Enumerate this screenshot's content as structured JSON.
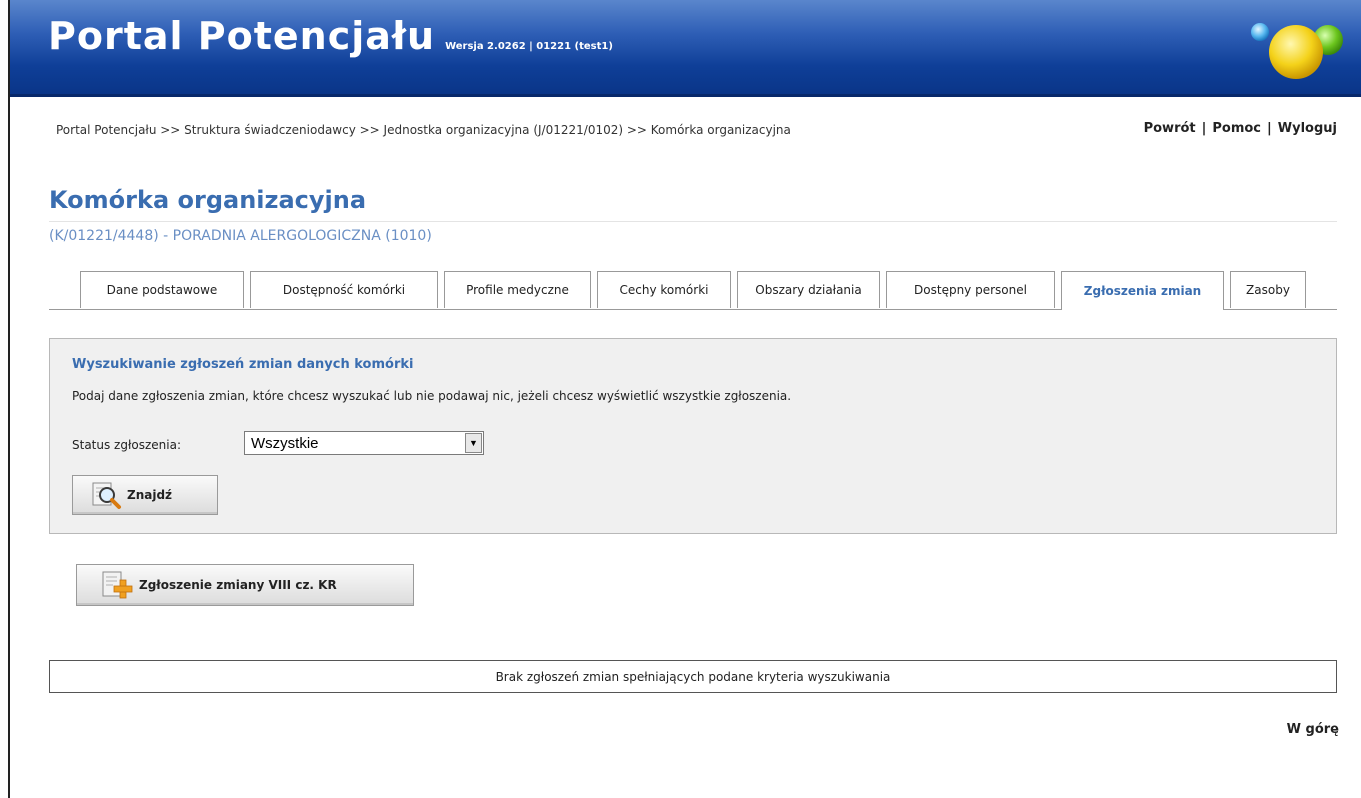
{
  "header": {
    "app_title": "Portal Potencjału",
    "version": "Wersja 2.0262 | 01221 (test1)"
  },
  "breadcrumb": "Portal Potencjału >> Struktura świadczeniodawcy >> Jednostka organizacyjna (J/01221/0102) >> Komórka organizacyjna",
  "toplinks": {
    "back": "Powrót",
    "help": "Pomoc",
    "logout": "Wyloguj",
    "separator": "|"
  },
  "page": {
    "title": "Komórka organizacyjna",
    "subtitle": "(K/01221/4448) - PORADNIA ALERGOLOGICZNA (1010)"
  },
  "tabs": [
    {
      "label": "Dane podstawowe",
      "active": false
    },
    {
      "label": "Dostępność komórki",
      "active": false
    },
    {
      "label": "Profile medyczne",
      "active": false
    },
    {
      "label": "Cechy komórki",
      "active": false
    },
    {
      "label": "Obszary działania",
      "active": false
    },
    {
      "label": "Dostępny personel",
      "active": false
    },
    {
      "label": "Zgłoszenia zmian",
      "active": true
    },
    {
      "label": "Zasoby",
      "active": false
    }
  ],
  "search": {
    "heading": "Wyszukiwanie zgłoszeń zmian danych komórki",
    "description": "Podaj dane zgłoszenia zmian, które chcesz wyszukać lub nie podawaj nic, jeżeli chcesz wyświetlić wszystkie zgłoszenia.",
    "status_label": "Status zgłoszenia:",
    "status_value": "Wszystkie",
    "find_button": "Znajdź"
  },
  "actions": {
    "new_change_button": "Zgłoszenie zmiany VIII cz. KR"
  },
  "result_message": "Brak zgłoszeń zmian spełniających podane kryteria wyszukiwania",
  "go_top": "W górę",
  "colors": {
    "header_blue": "#0f3f98",
    "title_blue": "#3a6db0",
    "panel_bg": "#f0f0f0"
  }
}
